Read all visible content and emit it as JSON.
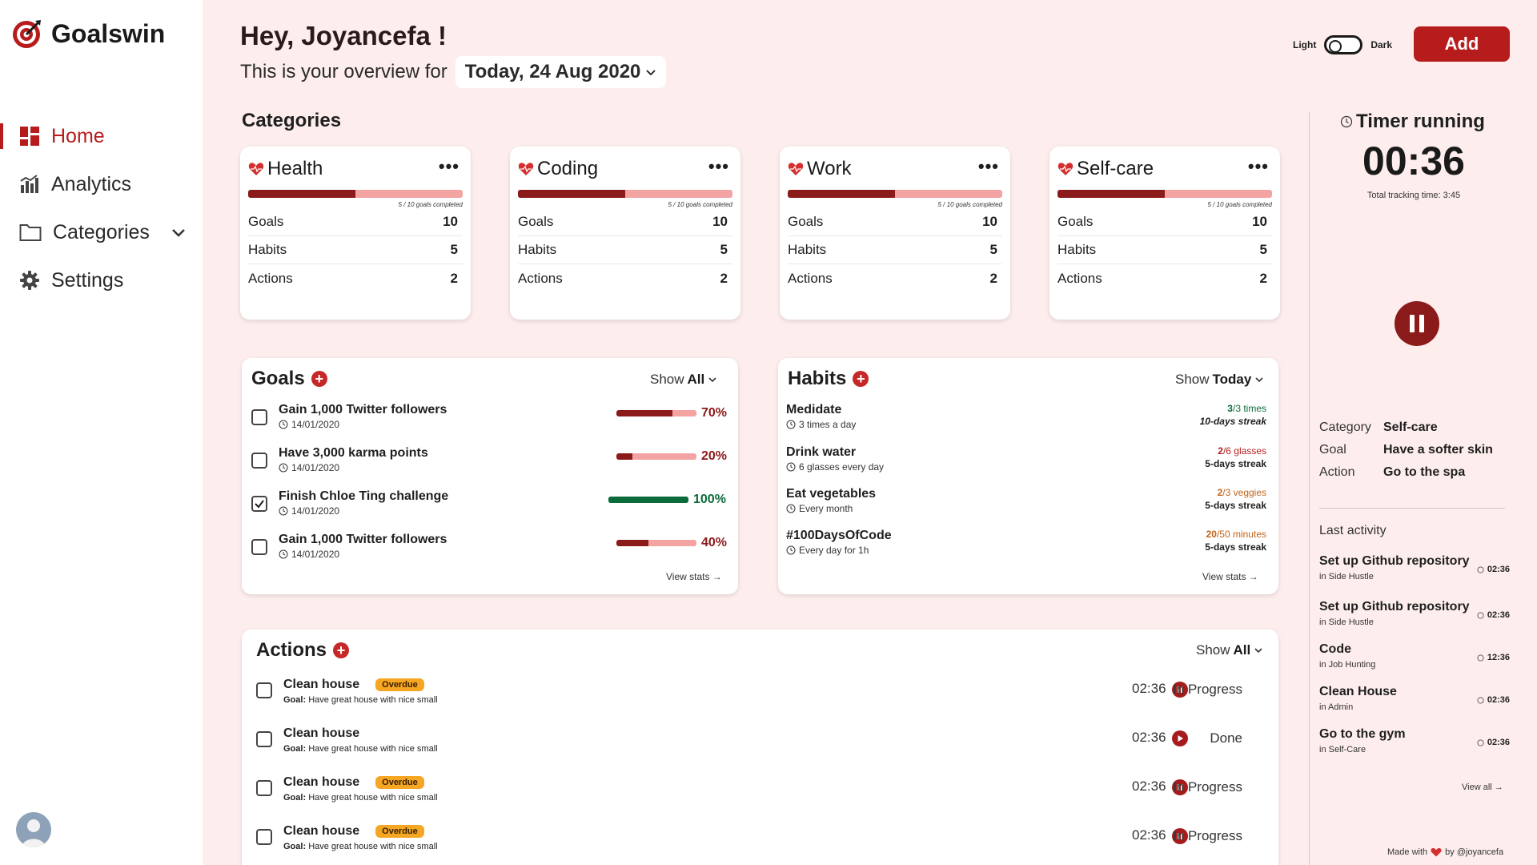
{
  "app": {
    "name": "Goalswin"
  },
  "nav": {
    "items": [
      {
        "label": "Home",
        "icon": "dashboard-icon"
      },
      {
        "label": "Analytics",
        "icon": "bar-chart-icon"
      },
      {
        "label": "Categories",
        "icon": "folder-icon"
      },
      {
        "label": "Settings",
        "icon": "gear-icon"
      }
    ]
  },
  "header": {
    "greeting": "Hey, Joyancefa !",
    "overview_label": "This is your overview for",
    "date": "Today, 24 Aug 2020",
    "theme_light": "Light",
    "theme_dark": "Dark",
    "add_label": "Add"
  },
  "categories": {
    "title": "Categories",
    "cards": [
      {
        "name": "Health",
        "progress": 0.5,
        "progress_text": "5 / 10 goals completed",
        "goals_label": "Goals",
        "goals": "10",
        "habits_label": "Habits",
        "habits": "5",
        "actions_label": "Actions",
        "actions": "2"
      },
      {
        "name": "Coding",
        "progress": 0.5,
        "progress_text": "5 / 10 goals completed",
        "goals_label": "Goals",
        "goals": "10",
        "habits_label": "Habits",
        "habits": "5",
        "actions_label": "Actions",
        "actions": "2"
      },
      {
        "name": "Work",
        "progress": 0.5,
        "progress_text": "5 / 10 goals completed",
        "goals_label": "Goals",
        "goals": "10",
        "habits_label": "Habits",
        "habits": "5",
        "actions_label": "Actions",
        "actions": "2"
      },
      {
        "name": "Self-care",
        "progress": 0.5,
        "progress_text": "5 / 10 goals completed",
        "goals_label": "Goals",
        "goals": "10",
        "habits_label": "Habits",
        "habits": "5",
        "actions_label": "Actions",
        "actions": "2"
      }
    ]
  },
  "goals": {
    "title": "Goals",
    "show_label": "Show",
    "show_value": "All",
    "view_stats": "View stats →",
    "items": [
      {
        "name": "Gain 1,000 Twitter followers",
        "date": "14/01/2020",
        "percent": "70%",
        "progress": 0.7,
        "checked": false
      },
      {
        "name": "Have 3,000 karma points",
        "date": "14/01/2020",
        "percent": "20%",
        "progress": 0.2,
        "checked": false
      },
      {
        "name": "Finish Chloe Ting challenge",
        "date": "14/01/2020",
        "percent": "100%",
        "progress": 1.0,
        "checked": true
      },
      {
        "name": "Gain 1,000 Twitter followers",
        "date": "14/01/2020",
        "percent": "40%",
        "progress": 0.4,
        "checked": false
      }
    ]
  },
  "habits": {
    "title": "Habits",
    "show_label": "Show",
    "show_value": "Today",
    "view_stats": "View stats →",
    "items": [
      {
        "name": "Medidate",
        "frequency": "3 times a day",
        "count_done": "3",
        "count_rest": "/3 times",
        "streak": "10-days streak",
        "color": "#0b6b3a"
      },
      {
        "name": "Drink water",
        "frequency": "6 glasses every day",
        "count_done": "2",
        "count_rest": "/6 glasses",
        "streak": "5-days streak",
        "color": "#b71c1c"
      },
      {
        "name": "Eat vegetables",
        "frequency": "Every month",
        "count_done": "2",
        "count_rest": "/3 veggies",
        "streak": "5-days streak",
        "color": "#c0641a"
      },
      {
        "name": "#100DaysOfCode",
        "frequency": "Every day for 1h",
        "count_done": "20",
        "count_rest": "/50 minutes",
        "streak": "5-days streak",
        "color": "#c0641a"
      }
    ]
  },
  "actions": {
    "title": "Actions",
    "show_label": "Show",
    "show_value": "All",
    "items": [
      {
        "name": "Clean house",
        "badge": "Overdue",
        "goal_label": "Goal:",
        "goal": "Have great house with nice small",
        "time": "02:36",
        "state": "pause",
        "status": "In Progress"
      },
      {
        "name": "Clean house",
        "badge": "",
        "goal_label": "Goal:",
        "goal": "Have great house with nice small",
        "time": "02:36",
        "state": "play",
        "status": "Done"
      },
      {
        "name": "Clean house",
        "badge": "Overdue",
        "goal_label": "Goal:",
        "goal": "Have great house with nice small",
        "time": "02:36",
        "state": "pause",
        "status": "In Progress"
      },
      {
        "name": "Clean house",
        "badge": "Overdue",
        "goal_label": "Goal:",
        "goal": "Have great house with nice small",
        "time": "02:36",
        "state": "pause",
        "status": "In Progress"
      }
    ]
  },
  "timer": {
    "title": "Timer running",
    "value": "00:36",
    "total": "Total tracking time: 3:45",
    "category_label": "Category",
    "category": "Self-care",
    "goal_label": "Goal",
    "goal": "Have a softer skin",
    "action_label": "Action",
    "action": "Go to the spa"
  },
  "last_activity": {
    "title": "Last activity",
    "view_all": "View all →",
    "items": [
      {
        "name": "Set up Github repository",
        "context": "in Side Hustle",
        "time": "02:36"
      },
      {
        "name": "Set up Github repository",
        "context": "in Side Hustle",
        "time": "02:36"
      },
      {
        "name": "Code",
        "context": "in Job Hunting",
        "time": "12:36"
      },
      {
        "name": "Clean House",
        "context": "in Admin",
        "time": "02:36"
      },
      {
        "name": "Go to the gym",
        "context": "in Self-Care",
        "time": "02:36"
      }
    ]
  },
  "footer": {
    "made_with": "Made with",
    "by": "by @joyancefa"
  },
  "colors": {
    "accent": "#b71c1c",
    "dark_red": "#8b1a1a",
    "light_red": "#f4a3a3",
    "success": "#0b6b3a",
    "overdue": "#f5a623",
    "background": "#fdeeed"
  }
}
